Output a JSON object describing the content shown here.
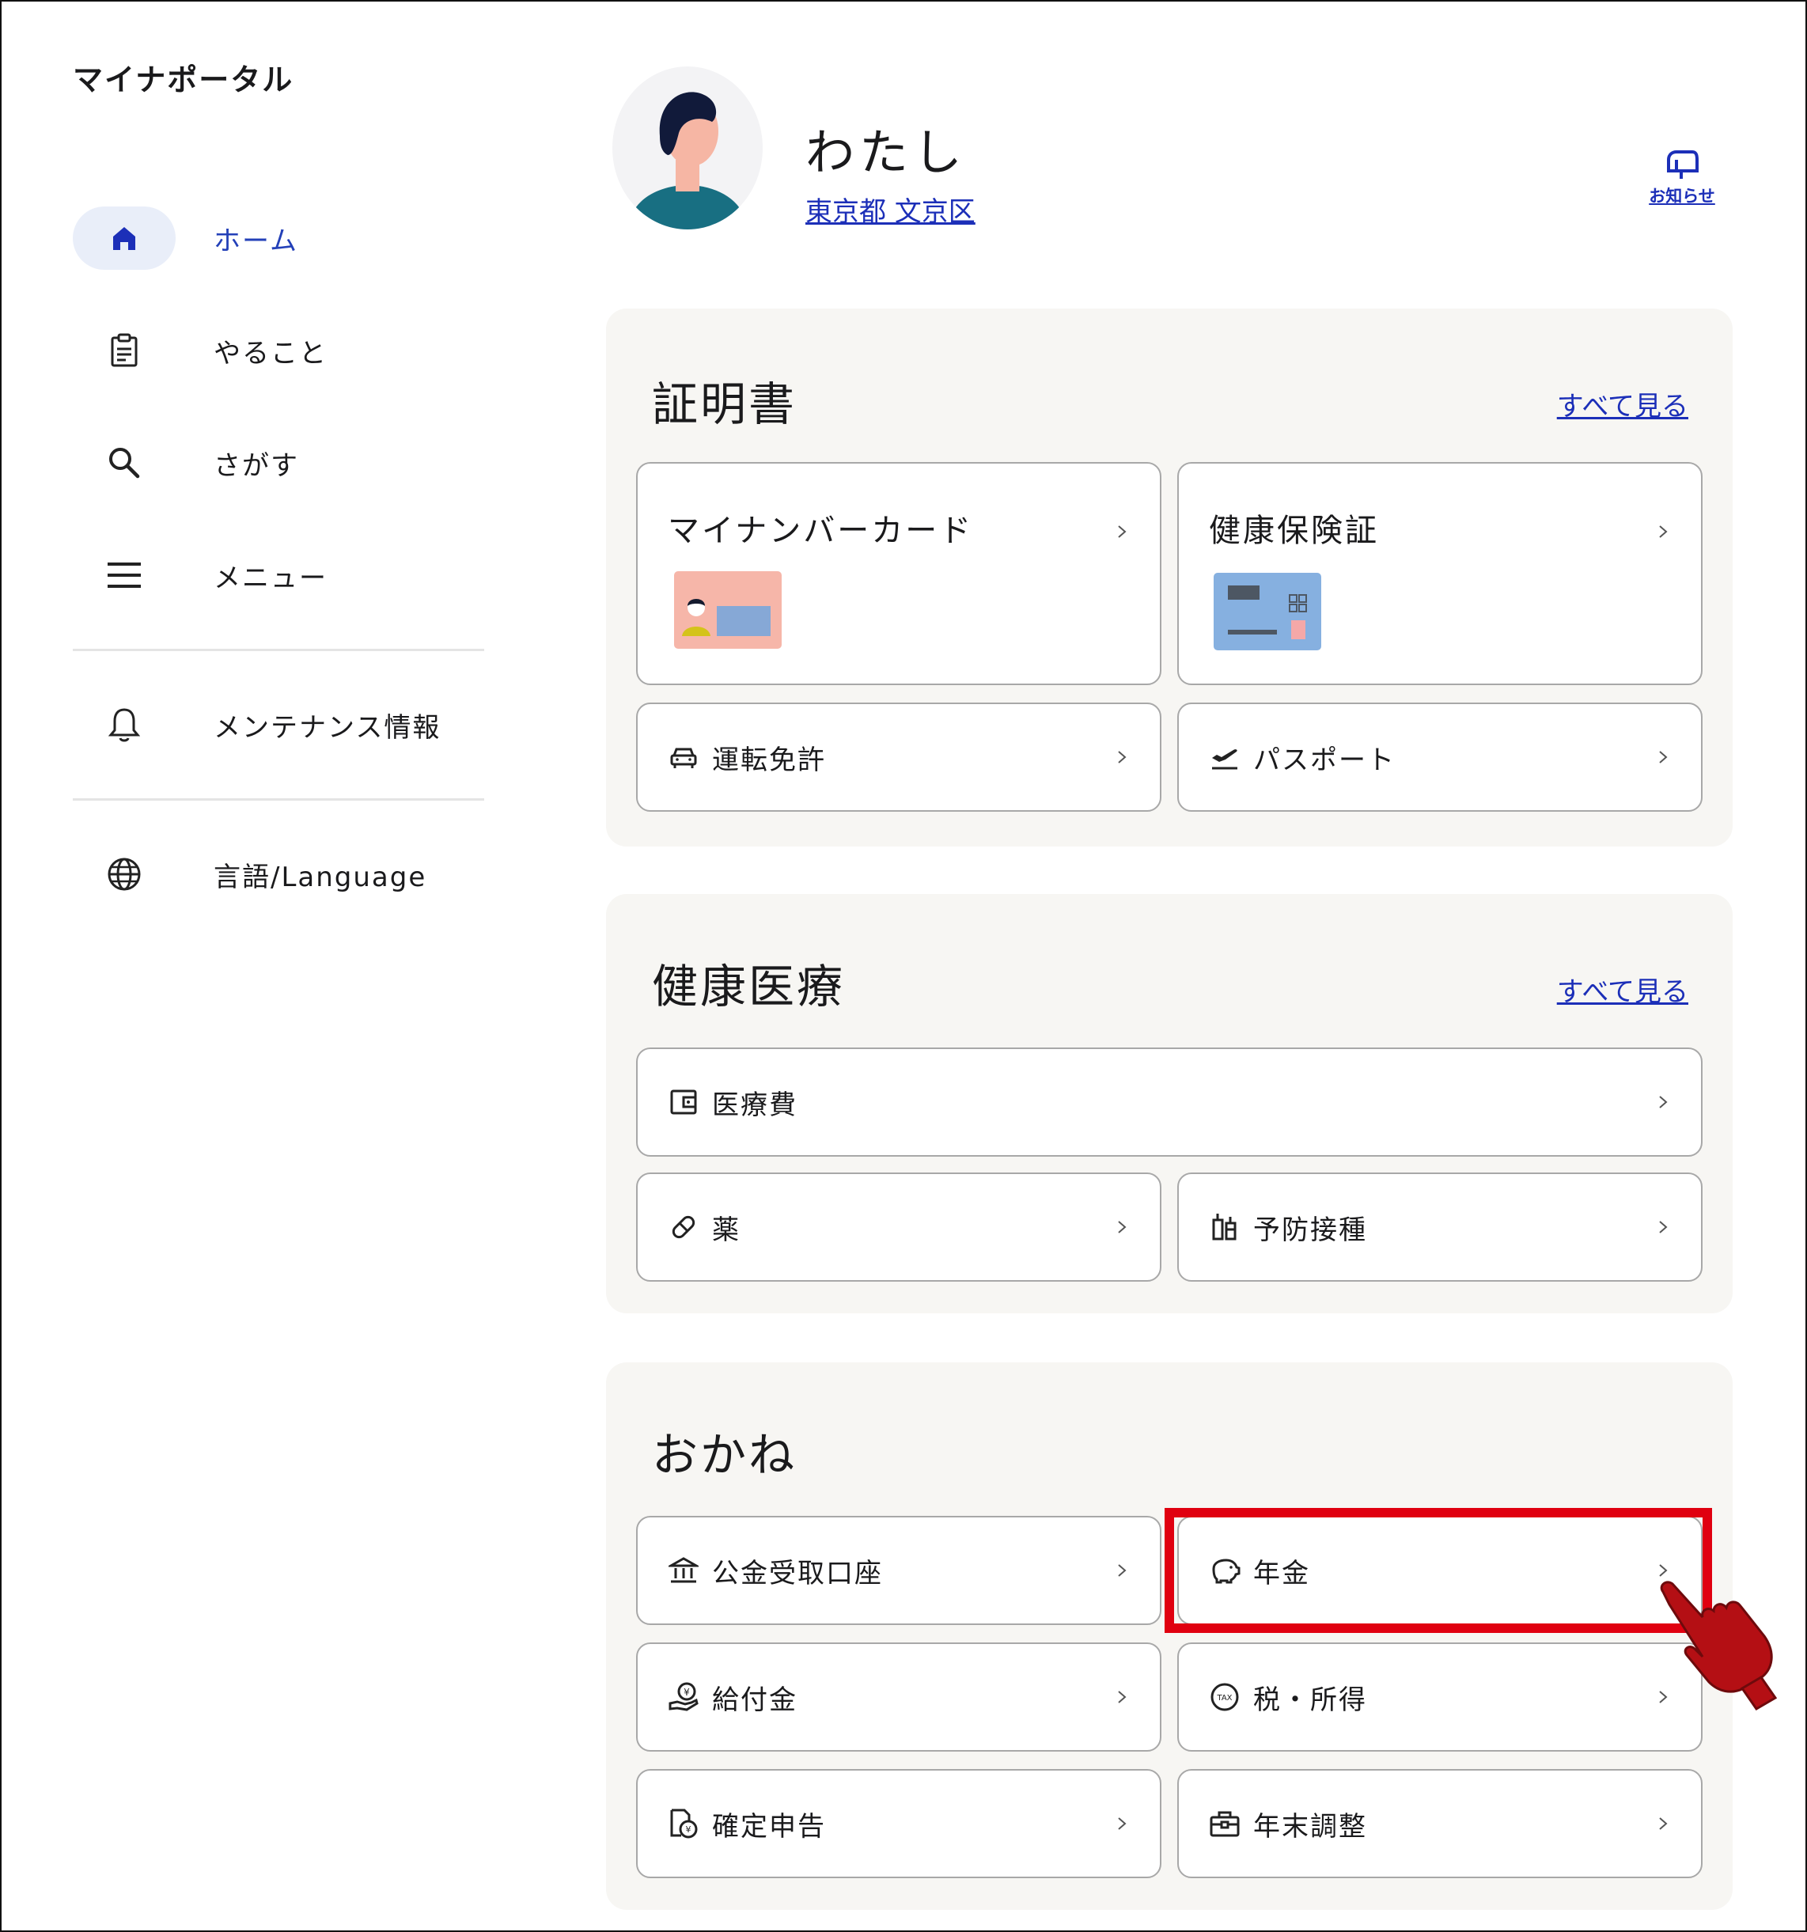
{
  "app": {
    "title": "マイナポータル"
  },
  "sidebar": {
    "items": [
      {
        "label": "ホーム",
        "icon": "home-icon",
        "active": true
      },
      {
        "label": "やること",
        "icon": "clipboard-icon"
      },
      {
        "label": "さがす",
        "icon": "search-icon"
      },
      {
        "label": "メニュー",
        "icon": "menu-icon"
      },
      {
        "label": "メンテナンス情報",
        "icon": "bell-icon"
      },
      {
        "label": "言語/Language",
        "icon": "globe-icon"
      }
    ]
  },
  "profile": {
    "name": "わたし",
    "location": "東京都 文京区"
  },
  "header": {
    "news_label": "お知らせ"
  },
  "sections": {
    "certificates": {
      "title": "証明書",
      "see_all": "すべて見る",
      "cards": [
        {
          "label": "マイナンバーカード"
        },
        {
          "label": "健康保険証"
        },
        {
          "label": "運転免許",
          "icon": "car-icon"
        },
        {
          "label": "パスポート",
          "icon": "airplane-icon"
        }
      ]
    },
    "health": {
      "title": "健康医療",
      "see_all": "すべて見る",
      "cards": [
        {
          "label": "医療費",
          "icon": "wallet-icon"
        },
        {
          "label": "薬",
          "icon": "pill-icon"
        },
        {
          "label": "予防接種",
          "icon": "vaccine-icon"
        }
      ]
    },
    "money": {
      "title": "おかね",
      "cards": [
        {
          "label": "公金受取口座",
          "icon": "bank-icon"
        },
        {
          "label": "年金",
          "icon": "piggy-bank-icon"
        },
        {
          "label": "給付金",
          "icon": "benefit-hand-icon"
        },
        {
          "label": "税・所得",
          "icon": "tax-icon"
        },
        {
          "label": "確定申告",
          "icon": "tax-return-icon"
        },
        {
          "label": "年末調整",
          "icon": "briefcase-icon"
        }
      ]
    }
  },
  "colors": {
    "accent": "#1c2fb8",
    "highlight": "#e00010",
    "section_bg": "#f7f6f3"
  }
}
